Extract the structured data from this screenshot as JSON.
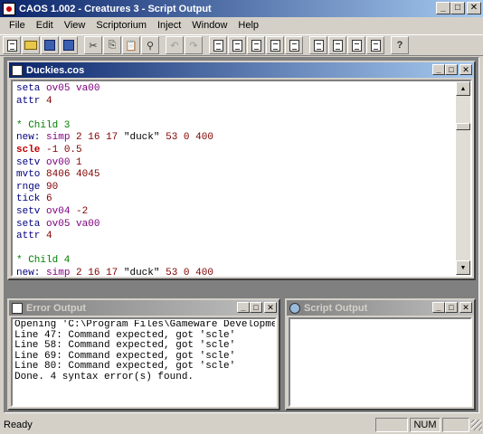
{
  "app": {
    "title": "CAOS 1.002 - Creatures 3 - Script Output"
  },
  "menu": [
    "File",
    "Edit",
    "View",
    "Scriptorium",
    "Inject",
    "Window",
    "Help"
  ],
  "toolbar": {
    "icons": [
      "new-file-icon",
      "open-folder-icon",
      "save-icon",
      "save-all-icon",
      "cut-icon",
      "copy-icon",
      "paste-icon",
      "find-icon",
      "undo-icon",
      "redo-icon",
      "script-tool-1-icon",
      "script-tool-2-icon",
      "script-tool-3-icon",
      "script-tool-4-icon",
      "script-tool-5-icon",
      "doc-tool-1-icon",
      "doc-tool-2-icon",
      "doc-tool-3-icon",
      "doc-tool-4-icon",
      "help-icon"
    ]
  },
  "editor": {
    "title": "Duckies.cos",
    "lines": [
      "seta ov05 va00",
      "attr 4",
      "",
      "* Child 3",
      "new: simp 2 16 17 \"duck\" 53 0 400",
      "scle -1 0.5",
      "setv ov00 1",
      "mvto 8406 4045",
      "rnge 90",
      "tick 6",
      "setv ov04 -2",
      "seta ov05 va00",
      "attr 4",
      "",
      "* Child 4",
      "new: simp 2 16 17 \"duck\" 53 0 400"
    ]
  },
  "error_output": {
    "title": "Error Output",
    "lines": [
      "Opening 'C:\\Program Files\\Gameware Developme",
      "Line 47: Command expected, got 'scle'",
      "Line 58: Command expected, got 'scle'",
      "Line 69: Command expected, got 'scle'",
      "Line 80: Command expected, got 'scle'",
      "Done. 4 syntax error(s) found."
    ]
  },
  "script_output": {
    "title": "Script Output",
    "lines": []
  },
  "status": {
    "message": "Ready",
    "num": "NUM"
  }
}
